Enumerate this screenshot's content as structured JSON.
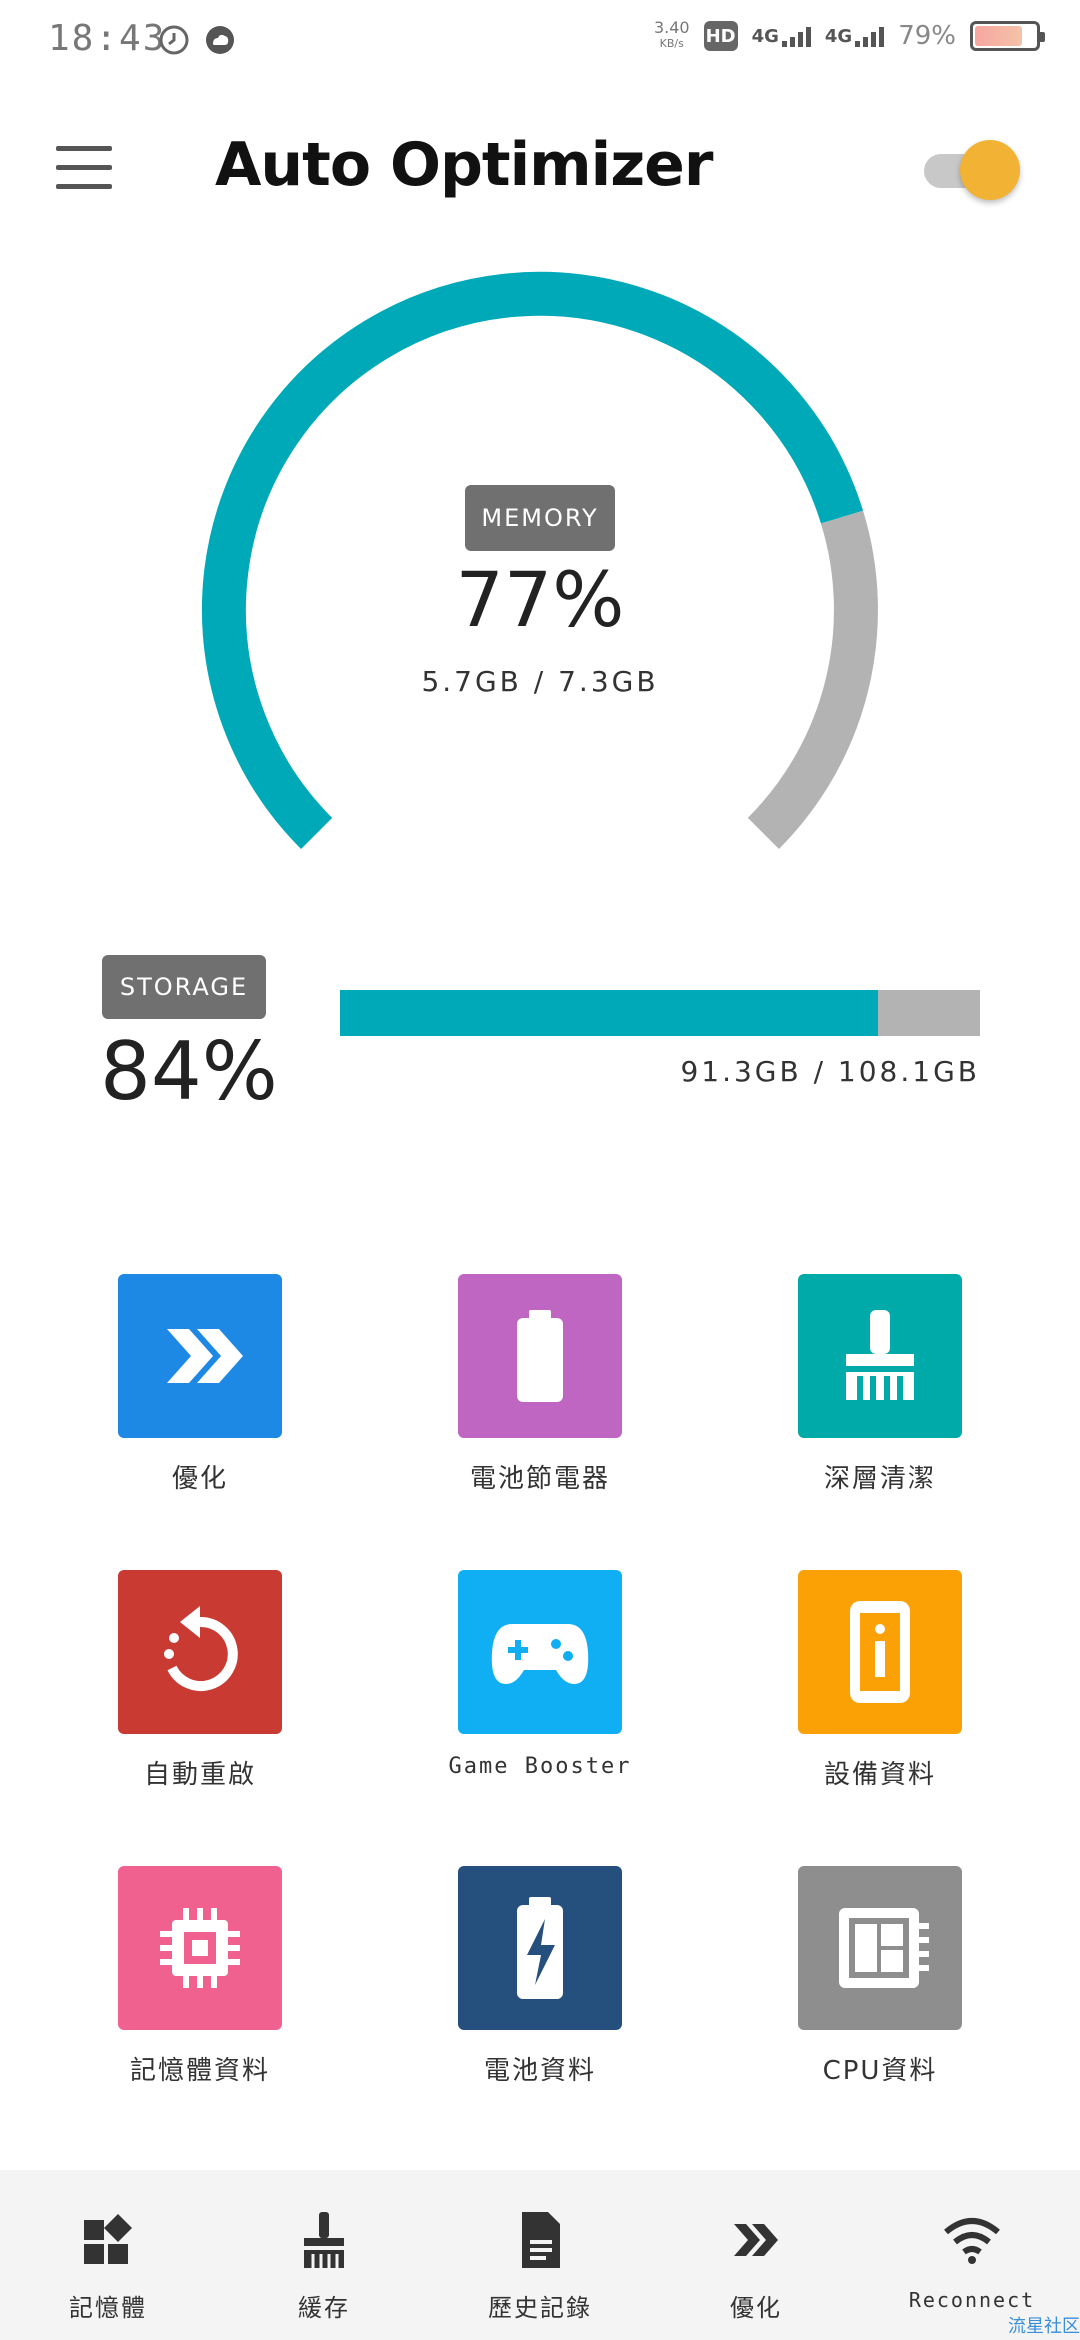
{
  "status_bar": {
    "time": "18:43",
    "speed_value": "3.40",
    "speed_unit": "KB/s",
    "hd": "HD",
    "sim1": "4G",
    "sim2": "4G",
    "battery": "79%"
  },
  "app_bar": {
    "title": "Auto Optimizer",
    "toggle_on": true
  },
  "memory": {
    "badge": "MEMORY",
    "percent": "77%",
    "usage": "5.7GB / 7.3GB",
    "fraction": 0.77
  },
  "storage": {
    "badge": "STORAGE",
    "percent": "84%",
    "usage": "91.3GB / 108.1GB",
    "fraction": 0.84
  },
  "colors": {
    "accent": "#00a9b8",
    "track": "#b3b3b3",
    "toggle": "#f2b233"
  },
  "grid": [
    {
      "label": "優化",
      "color": "#1e88e5",
      "icon": "double-chevron-icon"
    },
    {
      "label": "電池節電器",
      "color": "#bf66c2",
      "icon": "battery-icon"
    },
    {
      "label": "深層清潔",
      "color": "#00aaa8",
      "icon": "broom-icon"
    },
    {
      "label": "自動重啟",
      "color": "#c93a32",
      "icon": "restart-icon"
    },
    {
      "label": "Game Booster",
      "color": "#10aef3",
      "icon": "gamepad-icon"
    },
    {
      "label": "設備資料",
      "color": "#fba105",
      "icon": "phone-info-icon"
    },
    {
      "label": "記憶體資料",
      "color": "#f06190",
      "icon": "chip-icon"
    },
    {
      "label": "電池資料",
      "color": "#254f7c",
      "icon": "battery-charge-icon"
    },
    {
      "label": "CPU資料",
      "color": "#8e8e8e",
      "icon": "cpu-board-icon"
    }
  ],
  "bottom_nav": [
    {
      "label": "記憶體",
      "icon": "apps-icon"
    },
    {
      "label": "緩存",
      "icon": "broom-icon"
    },
    {
      "label": "歷史記錄",
      "icon": "document-icon"
    },
    {
      "label": "優化",
      "icon": "double-chevron-icon"
    },
    {
      "label": "Reconnect",
      "icon": "wifi-icon"
    }
  ],
  "watermark": "流星社区"
}
